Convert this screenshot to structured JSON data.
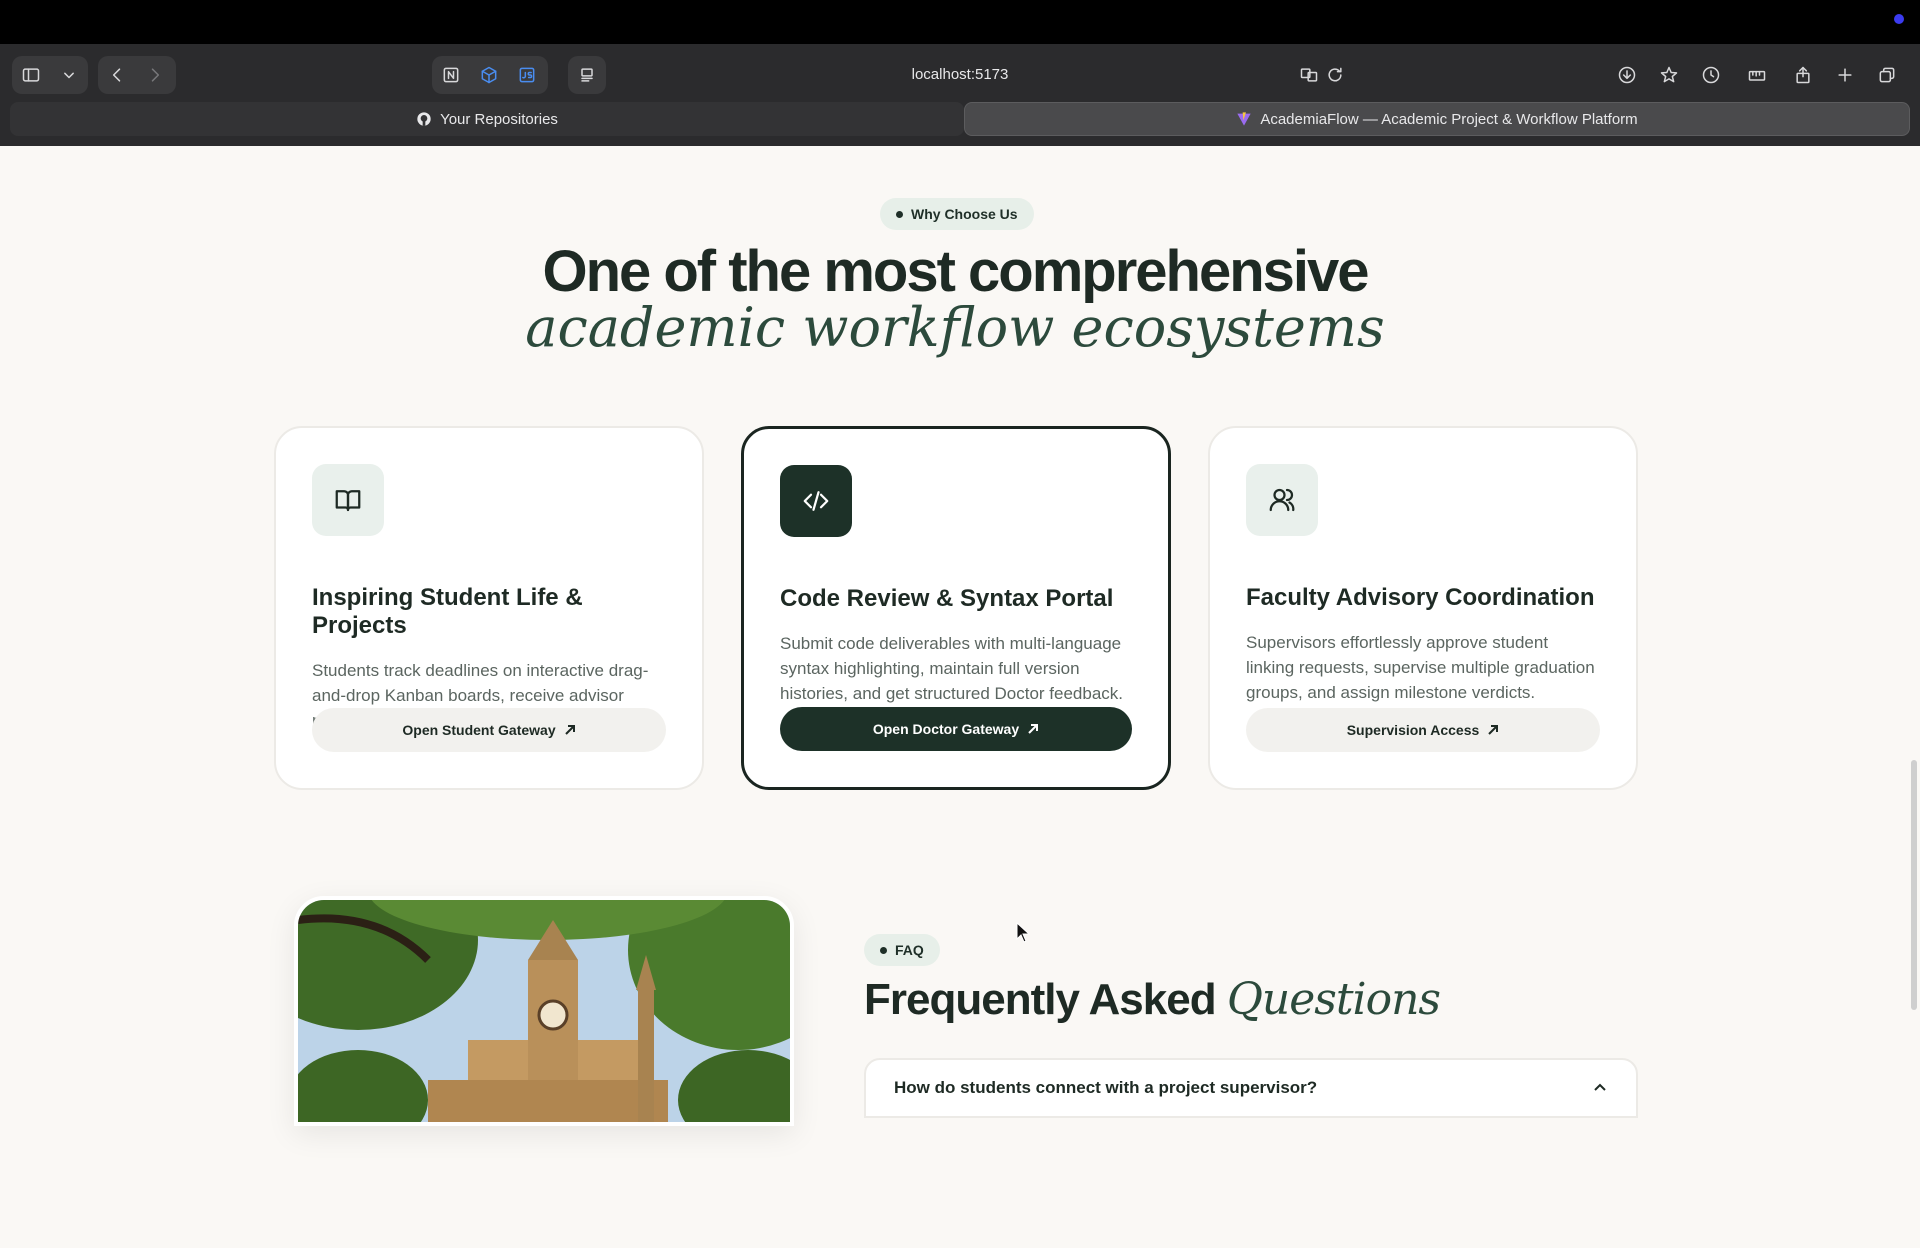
{
  "browser": {
    "url": "localhost:5173",
    "tabs": [
      {
        "label": "Your Repositories"
      },
      {
        "label": "AcademiaFlow — Academic Project & Workflow Platform"
      }
    ]
  },
  "hero": {
    "badge": "Why Choose Us",
    "title_line1": "One of the most comprehensive",
    "title_line2": "academic workflow ecosystems"
  },
  "cards": [
    {
      "icon": "book-icon",
      "title": "Inspiring Student Life & Projects",
      "description": "Students track deadlines on interactive drag-and-drop Kanban boards, receive advisor notifications, and generate team invite codes.",
      "button": "Open Student Gateway"
    },
    {
      "icon": "code-icon",
      "title": "Code Review & Syntax Portal",
      "description": "Submit code deliverables with multi-language syntax highlighting, maintain full version histories, and get structured Doctor feedback.",
      "button": "Open Doctor Gateway"
    },
    {
      "icon": "users-icon",
      "title": "Faculty Advisory Coordination",
      "description": "Supervisors effortlessly approve student linking requests, supervise multiple graduation groups, and assign milestone verdicts.",
      "button": "Supervision Access"
    }
  ],
  "faq": {
    "badge": "FAQ",
    "title_plain": "Frequently Asked",
    "title_italic": "Questions",
    "items": [
      {
        "question": "How do students connect with a project supervisor?"
      }
    ]
  },
  "colors": {
    "accent_dark": "#1d3128",
    "page_bg": "#faf8f5",
    "badge_bg": "#e7efe9"
  }
}
